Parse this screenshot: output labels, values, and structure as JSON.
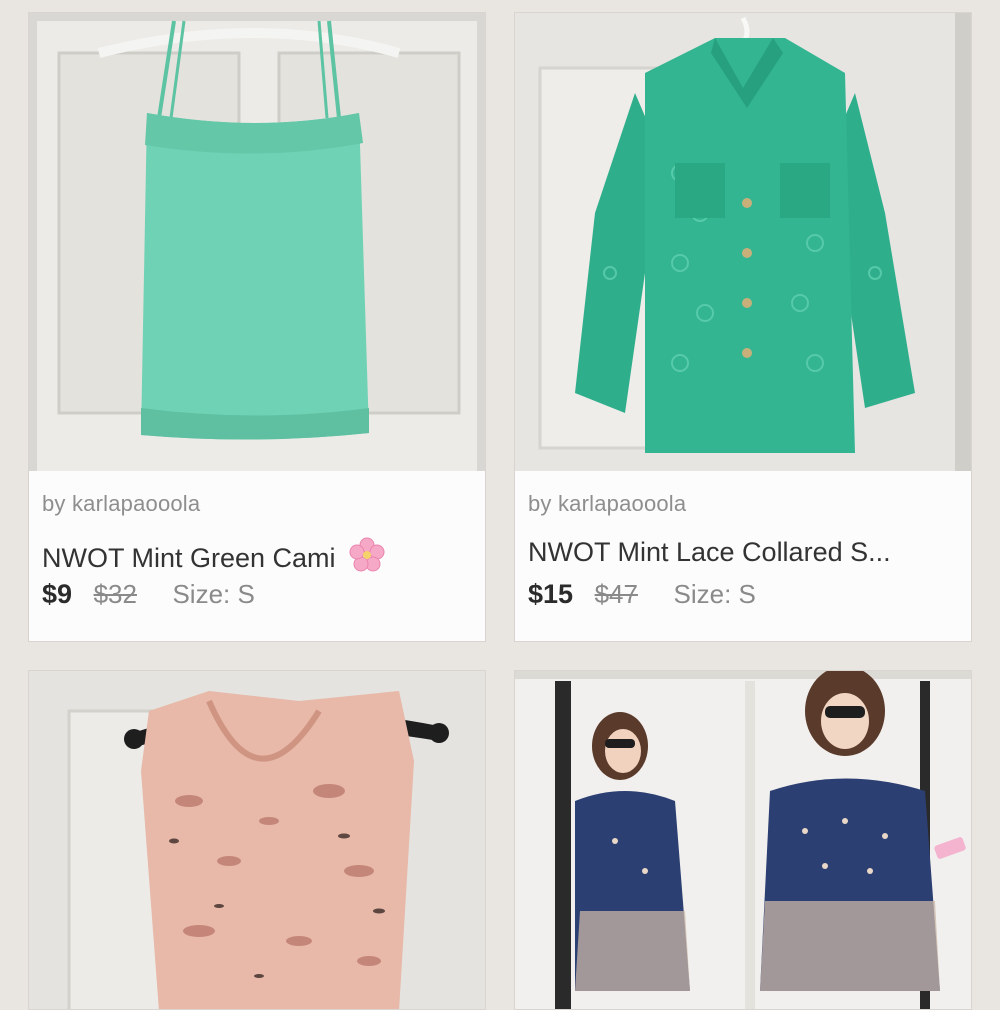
{
  "listings": [
    {
      "seller": "by karlapaooola",
      "title": "NWOT Mint Green Cami",
      "title_emoji": "cherry-blossom-icon",
      "price": "$9",
      "original_price": "$32",
      "size": "Size: S",
      "item_color": "#6fd2b4"
    },
    {
      "seller": "by karlapaooola",
      "title": "NWOT Mint Lace Collared S...",
      "price": "$15",
      "original_price": "$47",
      "size": "Size: S",
      "item_color": "#2fae8c"
    },
    {
      "item_color": "#e8b8a8"
    },
    {
      "item_color": "#2c3f73"
    }
  ],
  "colors": {
    "background": "#e9e5e1",
    "card": "#ffffff",
    "price": "#2b2b2b",
    "muted": "#8a8a8a"
  }
}
